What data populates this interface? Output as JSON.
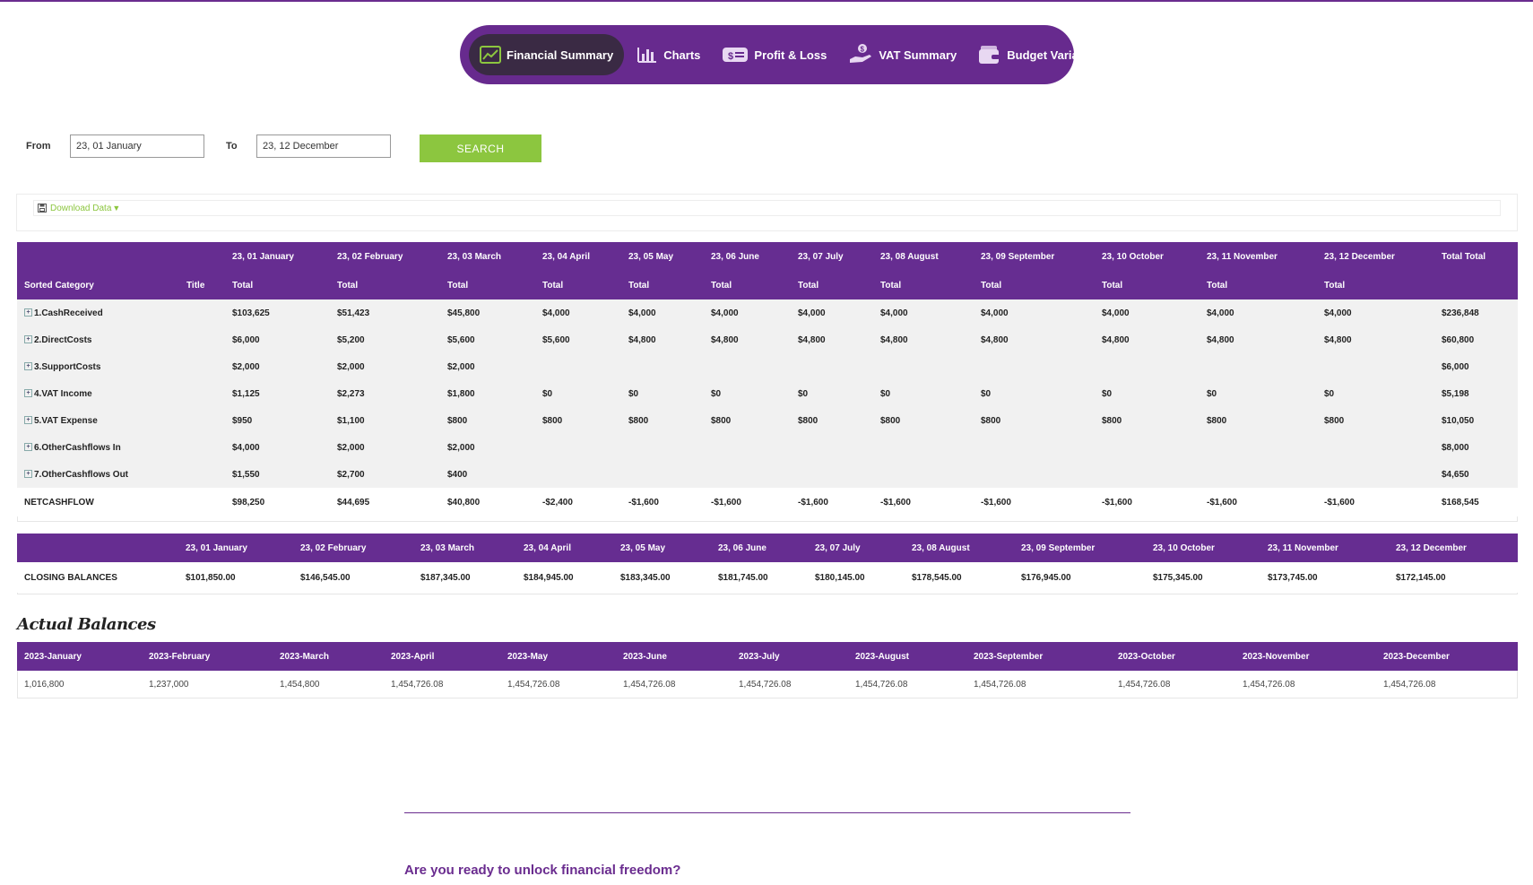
{
  "nav": {
    "items": [
      {
        "label": "Financial Summary",
        "icon": "line-chart-icon",
        "active": true
      },
      {
        "label": "Charts",
        "icon": "bar-chart-icon",
        "active": false
      },
      {
        "label": "Profit & Loss",
        "icon": "money-icon",
        "active": false
      },
      {
        "label": "VAT Summary",
        "icon": "hand-coin-icon",
        "active": false
      },
      {
        "label": "Budget Variance",
        "icon": "wallet-icon",
        "active": false
      }
    ]
  },
  "filter": {
    "from_label": "From",
    "from_value": "23, 01 January",
    "to_label": "To",
    "to_value": "23, 12 December",
    "search_label": "SEARCH"
  },
  "download": {
    "label": "Download Data",
    "arrow": "▼"
  },
  "summary": {
    "months": [
      "23, 01 January",
      "23, 02 February",
      "23, 03 March",
      "23, 04 April",
      "23, 05 May",
      "23, 06 June",
      "23, 07 July",
      "23, 08 August",
      "23, 09 September",
      "23, 10 October",
      "23, 11 November",
      "23, 12 December"
    ],
    "total_total_label": "Total Total",
    "sorted_category_label": "Sorted Category",
    "title_label": "Title",
    "total_label": "Total",
    "rows": [
      {
        "category": "1.CashReceived",
        "values": [
          "$103,625",
          "$51,423",
          "$45,800",
          "$4,000",
          "$4,000",
          "$4,000",
          "$4,000",
          "$4,000",
          "$4,000",
          "$4,000",
          "$4,000",
          "$4,000"
        ],
        "total": "$236,848"
      },
      {
        "category": "2.DirectCosts",
        "values": [
          "$6,000",
          "$5,200",
          "$5,600",
          "$5,600",
          "$4,800",
          "$4,800",
          "$4,800",
          "$4,800",
          "$4,800",
          "$4,800",
          "$4,800",
          "$4,800"
        ],
        "total": "$60,800"
      },
      {
        "category": "3.SupportCosts",
        "values": [
          "$2,000",
          "$2,000",
          "$2,000",
          "",
          "",
          "",
          "",
          "",
          "",
          "",
          "",
          ""
        ],
        "total": "$6,000"
      },
      {
        "category": "4.VAT Income",
        "values": [
          "$1,125",
          "$2,273",
          "$1,800",
          "$0",
          "$0",
          "$0",
          "$0",
          "$0",
          "$0",
          "$0",
          "$0",
          "$0"
        ],
        "total": "$5,198"
      },
      {
        "category": "5.VAT Expense",
        "values": [
          "$950",
          "$1,100",
          "$800",
          "$800",
          "$800",
          "$800",
          "$800",
          "$800",
          "$800",
          "$800",
          "$800",
          "$800"
        ],
        "total": "$10,050"
      },
      {
        "category": "6.OtherCashflows In",
        "values": [
          "$4,000",
          "$2,000",
          "$2,000",
          "",
          "",
          "",
          "",
          "",
          "",
          "",
          "",
          ""
        ],
        "total": "$8,000"
      },
      {
        "category": "7.OtherCashflows Out",
        "values": [
          "$1,550",
          "$2,700",
          "$400",
          "",
          "",
          "",
          "",
          "",
          "",
          "",
          "",
          ""
        ],
        "total": "$4,650"
      }
    ],
    "net": {
      "label": "NETCASHFLOW",
      "values": [
        "$98,250",
        "$44,695",
        "$40,800",
        "-$2,400",
        "-$1,600",
        "-$1,600",
        "-$1,600",
        "-$1,600",
        "-$1,600",
        "-$1,600",
        "-$1,600",
        "-$1,600"
      ],
      "total": "$168,545"
    }
  },
  "closing": {
    "label": "CLOSING BALANCES",
    "months": [
      "23, 01 January",
      "23, 02 February",
      "23, 03 March",
      "23, 04 April",
      "23, 05 May",
      "23, 06 June",
      "23, 07 July",
      "23, 08 August",
      "23, 09 September",
      "23, 10 October",
      "23, 11 November",
      "23, 12 December"
    ],
    "values": [
      "$101,850.00",
      "$146,545.00",
      "$187,345.00",
      "$184,945.00",
      "$183,345.00",
      "$181,745.00",
      "$180,145.00",
      "$178,545.00",
      "$176,945.00",
      "$175,345.00",
      "$173,745.00",
      "$172,145.00"
    ]
  },
  "actual": {
    "title": "Actual Balances",
    "months": [
      "2023-January",
      "2023-February",
      "2023-March",
      "2023-April",
      "2023-May",
      "2023-June",
      "2023-July",
      "2023-August",
      "2023-September",
      "2023-October",
      "2023-November",
      "2023-December"
    ],
    "values": [
      "1,016,800",
      "1,237,000",
      "1,454,800",
      "1,454,726.08",
      "1,454,726.08",
      "1,454,726.08",
      "1,454,726.08",
      "1,454,726.08",
      "1,454,726.08",
      "1,454,726.08",
      "1,454,726.08",
      "1,454,726.08"
    ]
  },
  "footer": {
    "cta": "Are you ready to unlock financial freedom?"
  },
  "colors": {
    "brand_purple": "#662d91",
    "accent_green": "#8cc63f"
  }
}
